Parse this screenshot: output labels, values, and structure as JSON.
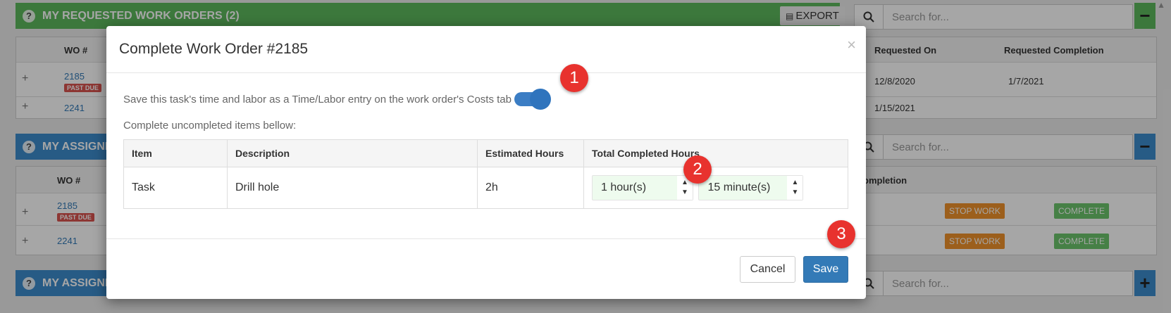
{
  "background": {
    "requested_panel": {
      "title": "MY REQUESTED WORK ORDERS",
      "count": "(2)",
      "export_label": "EXPORT",
      "search_placeholder": "Search for...",
      "toggle_symbol": "−",
      "columns": [
        "WO #",
        "Requested On",
        "Requested Completion"
      ],
      "rows": [
        {
          "wo": "2185",
          "badge": "PAST DUE",
          "requested_on": "12/8/2020",
          "requested_completion": "1/7/2021"
        },
        {
          "wo": "2241",
          "badge": "",
          "requested_on": "1/15/2021",
          "requested_completion": ""
        }
      ]
    },
    "assigned_panel": {
      "title": "MY ASSIGNE",
      "search_placeholder": "Search for...",
      "toggle_symbol": "−",
      "columns": [
        "WO #",
        "ompletion"
      ],
      "rows": [
        {
          "wo": "2185",
          "badge": "PAST DUE",
          "stop_label": "STOP WORK",
          "complete_label": "COMPLETE"
        },
        {
          "wo": "2241",
          "badge": "",
          "stop_label": "STOP WORK",
          "complete_label": "COMPLETE"
        }
      ]
    },
    "assigned_panel_2": {
      "title": "MY ASSIGNE",
      "search_placeholder": "Search for...",
      "toggle_symbol": "+"
    },
    "expand_symbol": "+",
    "help_symbol": "?"
  },
  "modal": {
    "title": "Complete Work Order #2185",
    "close_symbol": "×",
    "save_time_label": "Save this task's time and labor as a Time/Labor entry on the work order's Costs tab",
    "save_time_enabled": true,
    "complete_items_label": "Complete uncompleted items bellow:",
    "table": {
      "headers": [
        "Item",
        "Description",
        "Estimated Hours",
        "Total Completed Hours"
      ],
      "rows": [
        {
          "item": "Task",
          "description": "Drill hole",
          "estimated": "2h",
          "hours": "1 hour(s)",
          "minutes": "15 minute(s)"
        }
      ]
    },
    "cancel_label": "Cancel",
    "save_label": "Save"
  },
  "markers": [
    "1",
    "2",
    "3"
  ],
  "colors": {
    "green_panel": "#5cb85c",
    "blue_panel": "#3d8ccc",
    "primary": "#337ab7",
    "marker": "#e8322e",
    "past_due": "#d9534f",
    "stop_work": "#f0932b",
    "complete": "#6cc56c"
  }
}
